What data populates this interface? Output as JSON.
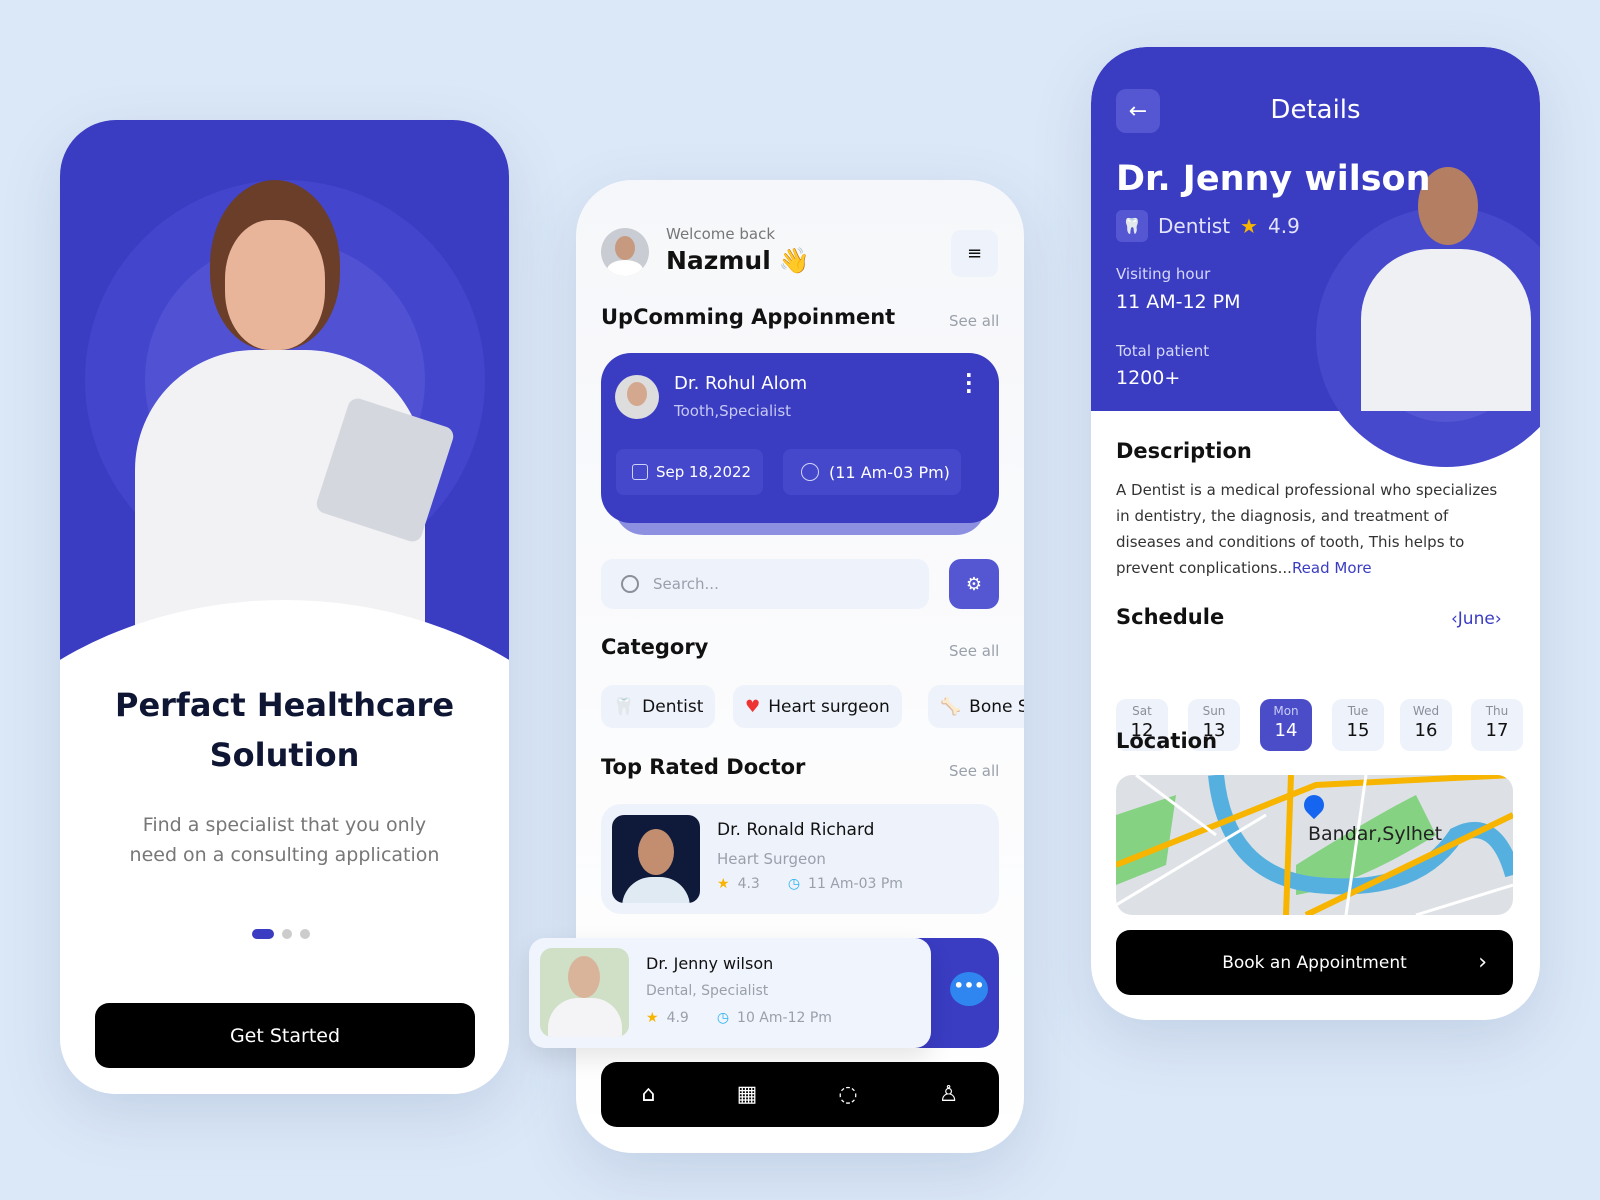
{
  "onboarding": {
    "title_line1": "Perfact Healthcare",
    "title_line2": "Solution",
    "subtitle_line1": "Find a specialist that you only",
    "subtitle_line2": "need on a consulting application",
    "button": "Get Started",
    "pages": 3,
    "active_page": 1
  },
  "home": {
    "welcome": "Welcome back",
    "user": "Nazmul",
    "wave": "👋",
    "upcoming_title": "UpComming Appoinment",
    "see_all": "See all",
    "appointment": {
      "doctor": "Dr. Rohul Alom",
      "specialty": "Tooth,Specialist",
      "date": "Sep 18,2022",
      "time": "(11 Am-03 Pm)"
    },
    "search_placeholder": "Search...",
    "category_title": "Category",
    "categories": [
      {
        "label": "Dentist",
        "icon": "tooth-icon"
      },
      {
        "label": "Heart surgeon",
        "icon": "heart-icon"
      },
      {
        "label": "Bone S",
        "icon": "bone-icon"
      }
    ],
    "top_title": "Top Rated Doctor",
    "doctors": [
      {
        "name": "Dr. Ronald Richard",
        "specialty": "Heart Surgeon",
        "rating": "4.3",
        "hours": "11 Am-03 Pm"
      },
      {
        "name": "Dr. Jenny wilson",
        "specialty": "Dental, Specialist",
        "rating": "4.9",
        "hours": "10 Am-12 Pm"
      }
    ],
    "nav": [
      "home",
      "calendar",
      "chat",
      "profile"
    ],
    "accent": "#3a3cc2"
  },
  "details": {
    "title": "Details",
    "doctor": "Dr. Jenny wilson",
    "specialty": "Dentist",
    "rating": "4.9",
    "visiting_label": "Visiting hour",
    "visiting_value": "11 AM-12 PM",
    "patient_label": "Total patient",
    "patient_value": "1200+",
    "description_title": "Description",
    "description": "A Dentist is a medical professional who specializes in dentistry, the diagnosis, and treatment of diseases and conditions of tooth, This helps to prevent conplications...",
    "read_more": "Read More",
    "schedule_title": "Schedule",
    "month": "‹June›",
    "days": [
      {
        "d": "Sat",
        "n": "12"
      },
      {
        "d": "Sun",
        "n": "13"
      },
      {
        "d": "Mon",
        "n": "14"
      },
      {
        "d": "Tue",
        "n": "15"
      },
      {
        "d": "Wed",
        "n": "16"
      },
      {
        "d": "Thu",
        "n": "17"
      }
    ],
    "selected_day": "14",
    "location_title": "Location",
    "location": "Bandar,Sylhet",
    "book": "Book an Appointment"
  }
}
